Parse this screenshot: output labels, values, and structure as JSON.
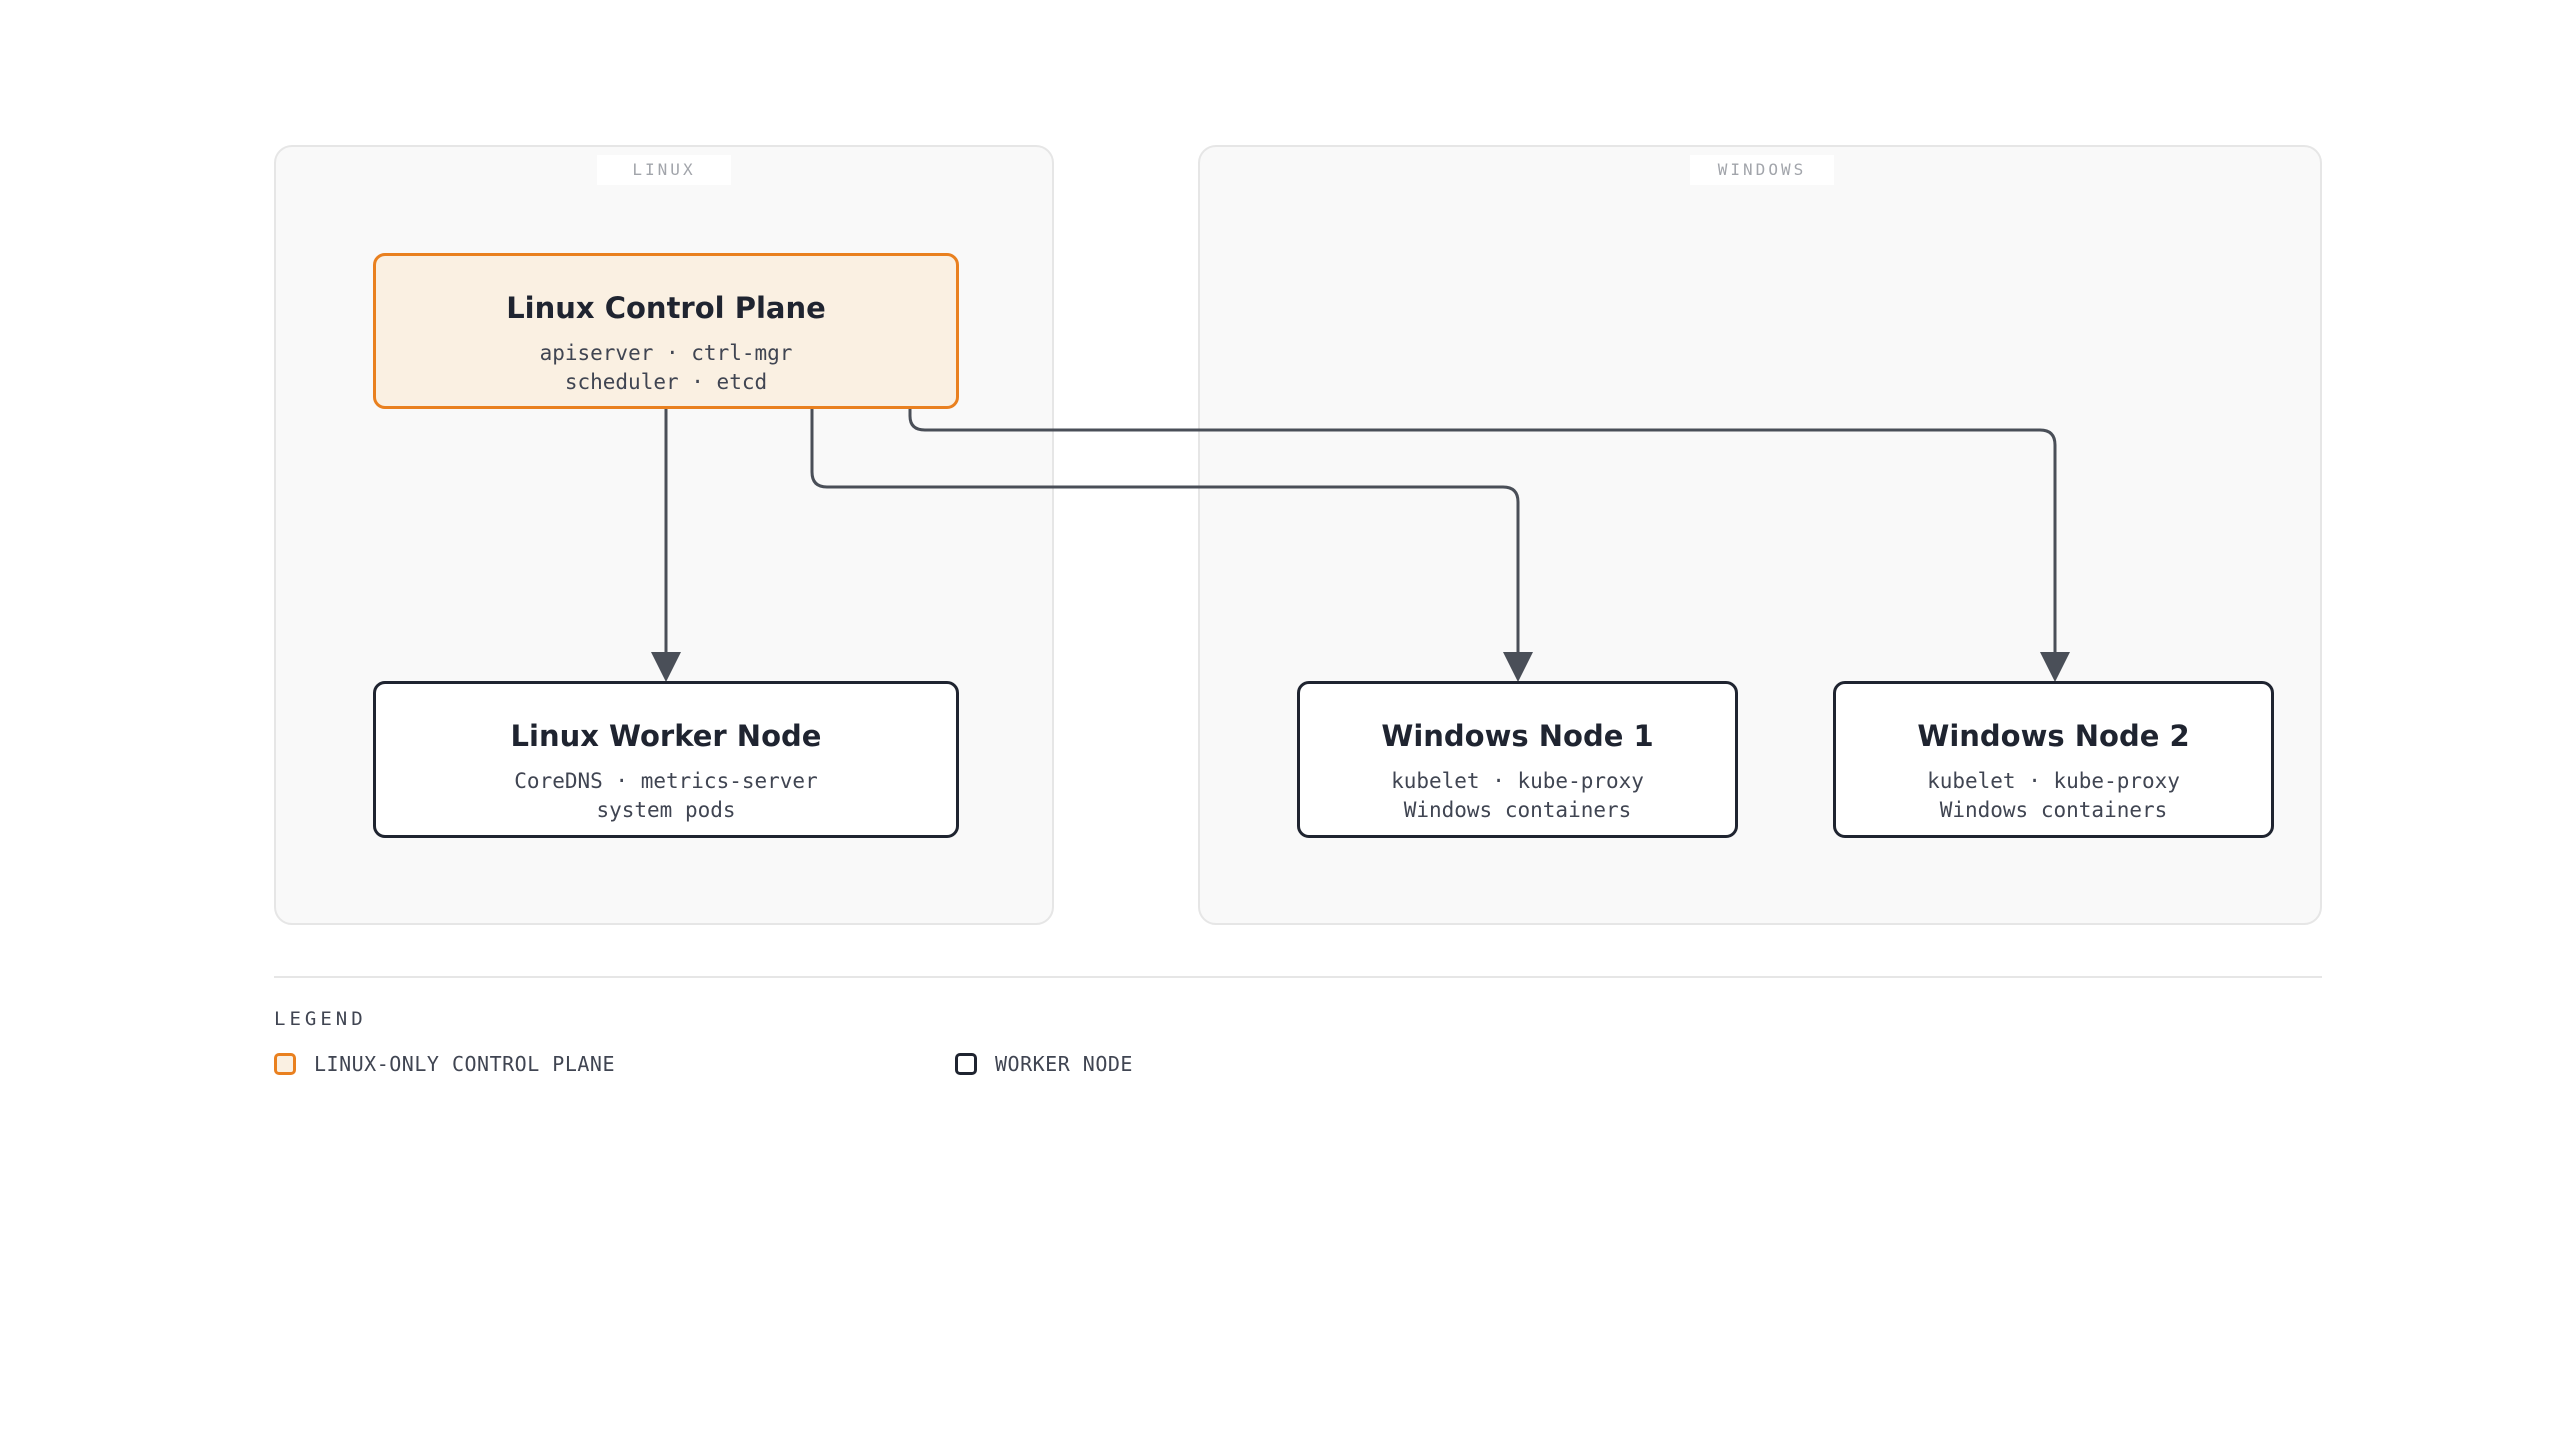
{
  "regions": {
    "linux": {
      "label": "LINUX"
    },
    "windows": {
      "label": "WINDOWS"
    }
  },
  "nodes": {
    "control_plane": {
      "title": "Linux Control Plane",
      "line1": "apiserver · ctrl-mgr",
      "line2": "scheduler · etcd"
    },
    "linux_worker": {
      "title": "Linux Worker Node",
      "line1": "CoreDNS · metrics-server",
      "line2": "system pods"
    },
    "windows_node_1": {
      "title": "Windows Node 1",
      "line1": "kubelet · kube-proxy",
      "line2": "Windows containers"
    },
    "windows_node_2": {
      "title": "Windows Node 2",
      "line1": "kubelet · kube-proxy",
      "line2": "Windows containers"
    }
  },
  "edges": [
    {
      "from": "control_plane",
      "to": "linux_worker"
    },
    {
      "from": "control_plane",
      "to": "windows_node_1"
    },
    {
      "from": "control_plane",
      "to": "windows_node_2"
    }
  ],
  "legend": {
    "title": "LEGEND",
    "items": [
      {
        "label": "LINUX-ONLY CONTROL PLANE"
      },
      {
        "label": "WORKER NODE"
      }
    ]
  },
  "colors": {
    "control_plane_border": "#e9801f",
    "control_plane_fill": "#faf0e2",
    "node_border": "#1f2430",
    "edge": "#4a4f58",
    "region_fill": "#f9f9f9"
  }
}
